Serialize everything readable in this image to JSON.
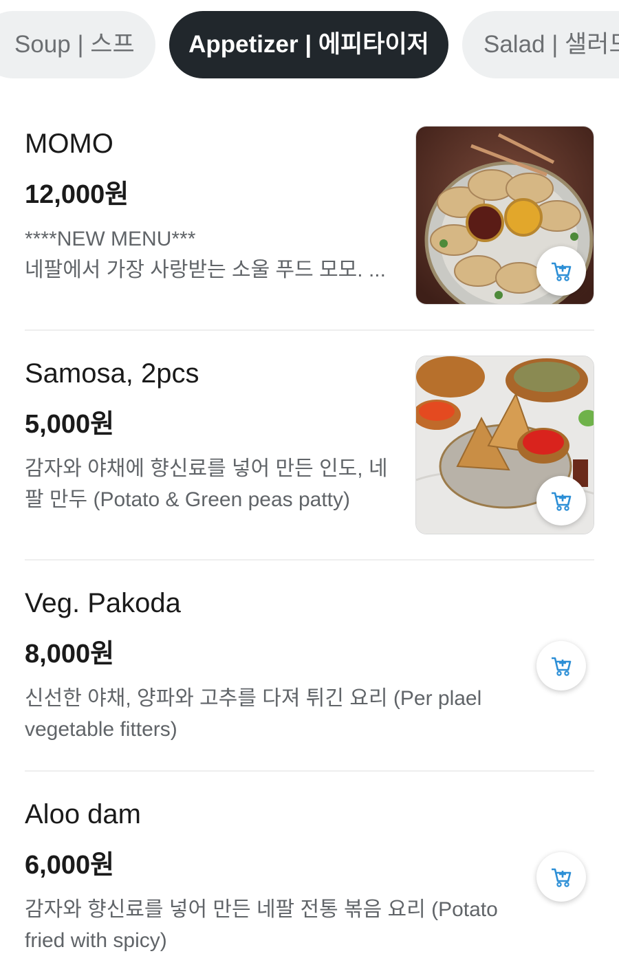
{
  "tabs": [
    {
      "label": "Soup | 스프",
      "active": false
    },
    {
      "label": "Appetizer | 에피타이저",
      "active": true
    },
    {
      "label": "Salad | 샐러드",
      "active": false
    }
  ],
  "items": [
    {
      "name": "MOMO",
      "price": "12,000원",
      "desc_lines": [
        "****NEW MENU***",
        "네팔에서 가장 사랑받는 소울 푸드 모모. ..."
      ],
      "has_image": true,
      "image": "momo-dumplings-photo",
      "cart_icon": "add-to-cart-icon"
    },
    {
      "name": "Samosa, 2pcs",
      "price": "5,000원",
      "desc_lines": [
        "감자와 야채에 향신료를 넣어 만든 인도, 네",
        "팔 만두 (Potato & Green peas patty)"
      ],
      "has_image": true,
      "image": "samosa-photo",
      "cart_icon": "add-to-cart-icon"
    },
    {
      "name": "Veg. Pakoda",
      "price": "8,000원",
      "desc_lines": [
        "신선한 야채, 양파와 고추를 다져 튀긴 요리 (Per plael",
        "vegetable fitters)"
      ],
      "has_image": false,
      "cart_icon": "add-to-cart-icon"
    },
    {
      "name": "Aloo dam",
      "price": "6,000원",
      "desc_lines": [
        "감자와 향신료를 넣어 만든 네팔 전통 볶음 요리 (Potato",
        "fried with spicy)"
      ],
      "has_image": false,
      "cart_icon": "add-to-cart-icon"
    }
  ],
  "colors": {
    "accent": "#2d8fd6",
    "tab_active_bg": "#21272c",
    "tab_inactive_bg": "#eef0f1"
  }
}
